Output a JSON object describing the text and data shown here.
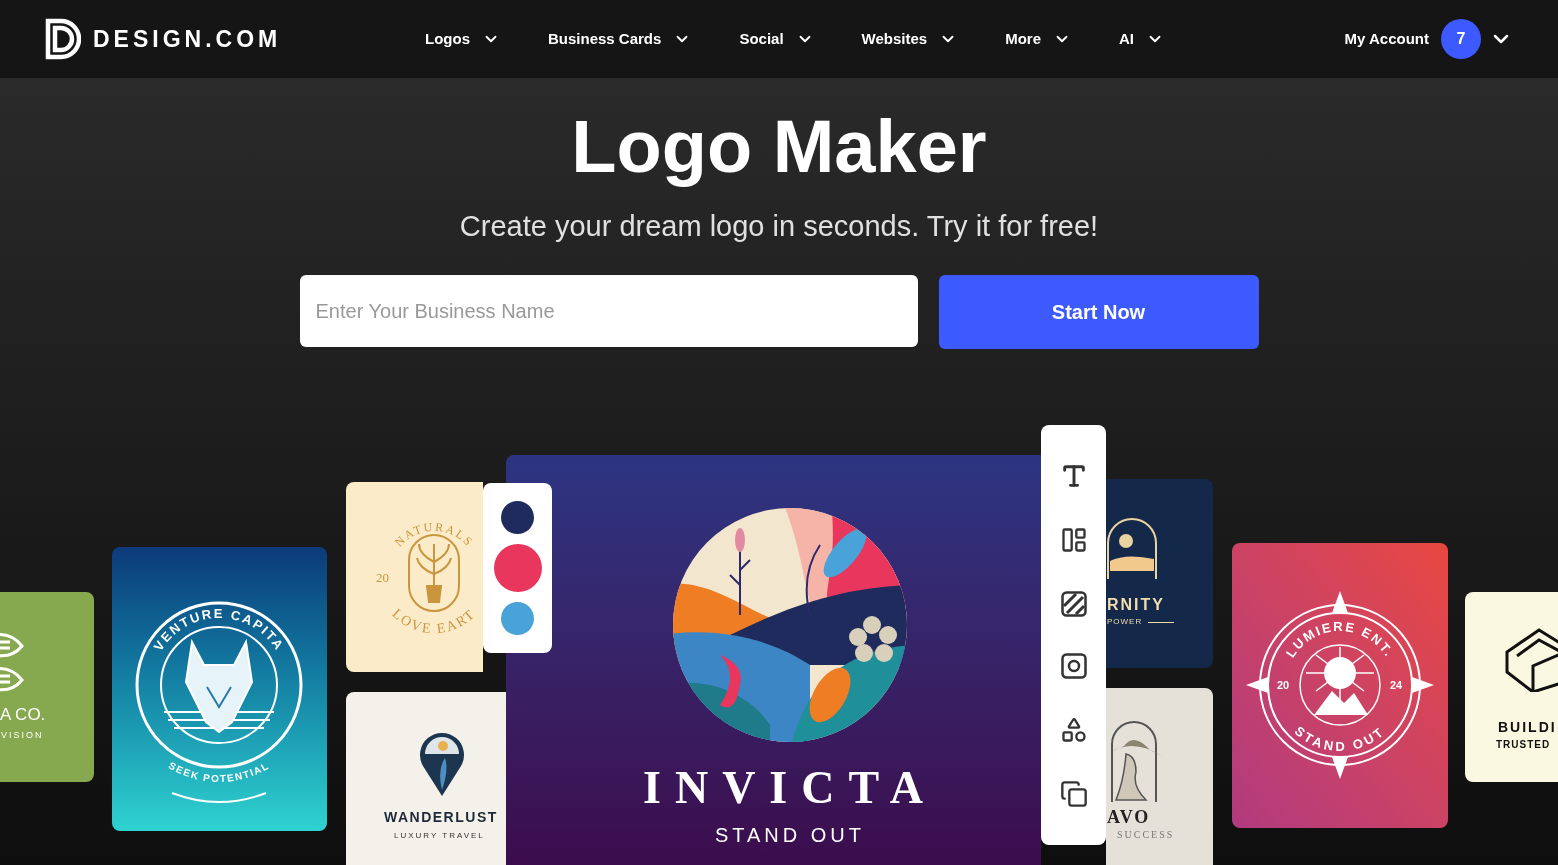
{
  "nav": {
    "logo": "DESIGN.COM",
    "items": [
      {
        "label": "Logos"
      },
      {
        "label": "Business Cards"
      },
      {
        "label": "Social"
      },
      {
        "label": "Websites"
      },
      {
        "label": "More"
      },
      {
        "label": "AI"
      }
    ],
    "account": {
      "label": "My Account",
      "badge": "7"
    }
  },
  "hero": {
    "title": "Logo Maker",
    "subtitle": "Create your dream logo in seconds. Try it for free!",
    "search": {
      "placeholder": "Enter Your Business Name"
    },
    "button": "Start Now"
  },
  "showcase": {
    "palette": [
      {
        "color": "#1f2b5c"
      },
      {
        "color": "#e8365d"
      },
      {
        "color": "#4aa3d8"
      }
    ],
    "cards": [
      {
        "kind": "fish",
        "texts": [
          "A CO.",
          "VISION"
        ]
      },
      {
        "kind": "wolf",
        "texts": [
          "VENTURE CAPITA",
          "SEEK POTENTIAL"
        ]
      },
      {
        "kind": "naturals",
        "texts": [
          "NATURALS",
          "20",
          "LOVE EART"
        ]
      },
      {
        "kind": "wanderlust",
        "texts": [
          "WANDERLUST",
          "LUXURY TRAVEL"
        ]
      },
      {
        "kind": "invicta",
        "texts": [
          "INVICTA",
          "STAND OUT"
        ]
      },
      {
        "kind": "eternity",
        "texts": [
          "RNITY",
          "POWER"
        ]
      },
      {
        "kind": "bravo",
        "texts": [
          "AVO",
          "SUCCESS"
        ]
      },
      {
        "kind": "lumiere",
        "texts": [
          "LUMIERE ENT.",
          "20",
          "24",
          "STAND OUT"
        ]
      },
      {
        "kind": "build",
        "texts": [
          "BUILDI",
          "TRUSTED"
        ]
      }
    ]
  }
}
